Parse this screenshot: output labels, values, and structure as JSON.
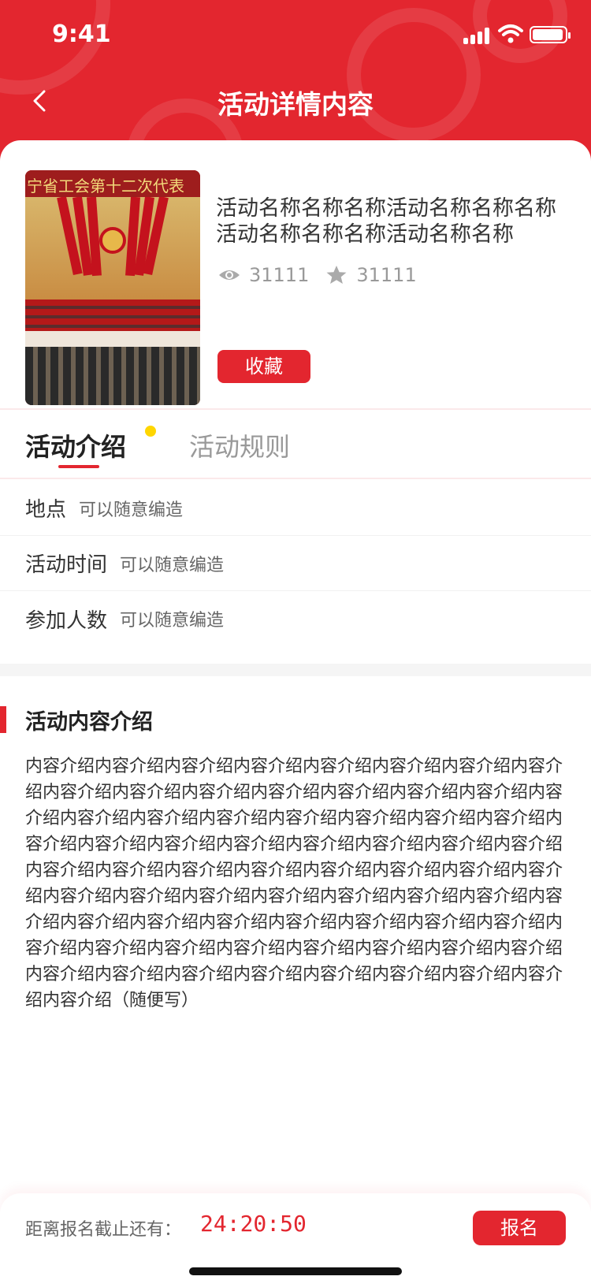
{
  "status_bar": {
    "time": "9:41"
  },
  "header": {
    "title": "活动详情内容"
  },
  "cover": {
    "banner_text": "宁省工会第十二次代表"
  },
  "activity": {
    "name": "活动名称名称名称活动名称名称名称活动名称名称名称活动名称名称",
    "views": "31111",
    "stars": "31111",
    "favorite_label": "收藏"
  },
  "tabs": [
    {
      "label": "活动介绍"
    },
    {
      "label": "活动规则"
    }
  ],
  "info": [
    {
      "key": "地点",
      "value": "可以随意编造"
    },
    {
      "key": "活动时间",
      "value": "可以随意编造"
    },
    {
      "key": "参加人数",
      "value": "可以随意编造"
    }
  ],
  "section": {
    "title": "活动内容介绍",
    "body": "内容介绍内容介绍内容介绍内容介绍内容介绍内容介绍内容介绍内容介绍内容介绍内容介绍内容介绍内容介绍内容介绍内容介绍内容介绍内容介绍内容介绍内容介绍内容介绍内容介绍内容介绍内容介绍内容介绍内容介绍内容介绍内容介绍内容介绍内容介绍内容介绍内容介绍内容介绍内容介绍内容介绍内容介绍内容介绍内容介绍内容介绍内容介绍内容介绍内容介绍内容介绍内容介绍内容介绍内容介绍内容介绍内容介绍内容介绍内容介绍内容介绍内容介绍内容介绍内容介绍内容介绍内容介绍内容介绍内容介绍内容介绍内容介绍内容介绍内容介绍内容介绍内容介绍内容介绍内容介绍内容介绍内容介绍内容介绍内容介绍内容介绍内容介绍内容介绍（随便写）"
  },
  "footer": {
    "countdown_label": "距离报名截止还有：",
    "countdown": "24:20:50",
    "signup_label": "报名"
  },
  "colors": {
    "accent": "#e3262f",
    "badge_dot": "#ffd600"
  }
}
